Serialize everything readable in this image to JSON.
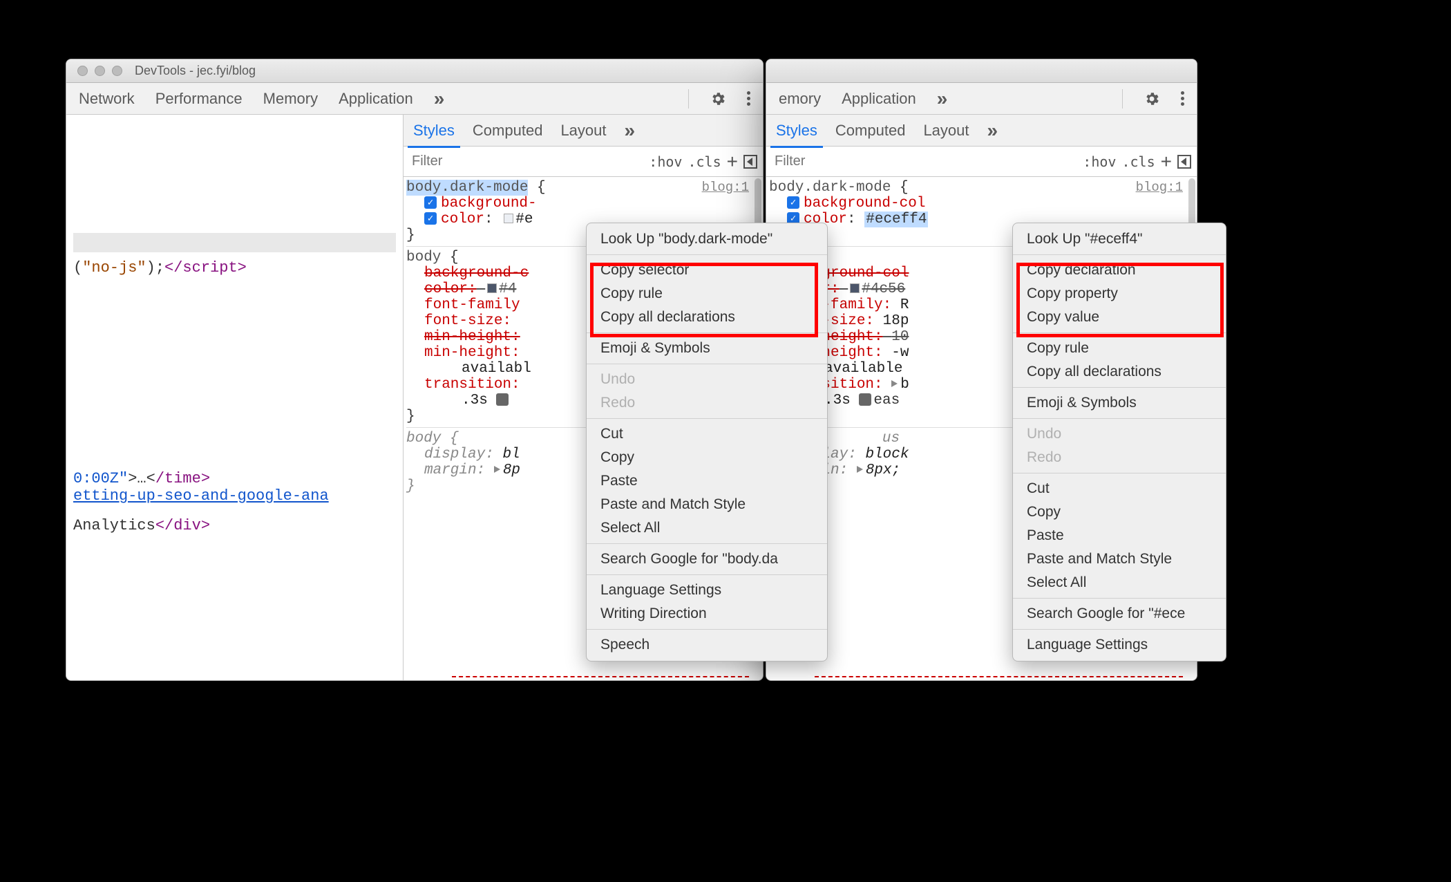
{
  "windowA": {
    "title": "DevTools - jec.fyi/blog",
    "tabs": [
      "Network",
      "Performance",
      "Memory",
      "Application"
    ],
    "more": "»",
    "dom": {
      "line1_pre": "(",
      "line1_str": "\"no-js\"",
      "line1_post": ");",
      "line1_close": "</script>",
      "line7_attr": "0:00Z\"",
      "line7_ell": ">…<",
      "line7_end": "/time>",
      "line8": "etting-up-seo-and-google-ana",
      "line10_text": "Analytics",
      "line10_close": "</div>"
    },
    "subtabs": [
      "Styles",
      "Computed",
      "Layout"
    ],
    "filter": {
      "placeholder": "Filter",
      "hov": ":hov",
      "cls": ".cls"
    },
    "rules": {
      "r1_sel": "body.dark-mode",
      "r1_brace": " {",
      "r1_origin": "blog:1",
      "r1_p1": "background-",
      "r1_p2_k": "color",
      "r1_p2_v": "#e",
      "r2_sel": "body",
      "r2_brace": " {",
      "r2_p1": "background-c",
      "r2_p2_k": "color:",
      "r2_p2_sw": "#4",
      "r2_p3": "font-family",
      "r2_p4": "font-size:",
      "r2_p5": "min-height:",
      "r2_p6": "min-height:",
      "r2_p6v": "availabl",
      "r2_p7": "transition:",
      "r2_p7v": ".3s ",
      "r3_sel": "body",
      "r3_brace": " {",
      "r3_p1_k": "display:",
      "r3_p1_v": "bl",
      "r3_p2_k": "margin:",
      "r3_p2_v": "8p"
    }
  },
  "windowB": {
    "tabs": [
      "emory",
      "Application"
    ],
    "more": "»",
    "subtabs": [
      "Styles",
      "Computed",
      "Layout"
    ],
    "filter": {
      "placeholder": "Filter",
      "hov": ":hov",
      "cls": ".cls"
    },
    "rules": {
      "r1_sel": "body.dark-mode",
      "r1_brace": " {",
      "r1_origin": "blog:1",
      "r1_p1": "background-col",
      "r1_p2_k": "color",
      "r1_p2_v": "#eceff4",
      "r2_sel": "body",
      "r2_brace": " {",
      "r2_p1": "background-col",
      "r2_p2_k": "color:",
      "r2_p2_sw": "#4c56",
      "r2_p3_k": "font-family:",
      "r2_p3_v": "R",
      "r2_p4_k": "font-size:",
      "r2_p4_v": "18p",
      "r2_p5_k": "min-height:",
      "r2_p5_v": "10",
      "r2_p6_k": "min-height:",
      "r2_p6_v": "-w",
      "r2_p6v2": "available",
      "r2_p7_k": "transition:",
      "r2_p7_v": "b",
      "r2_p7v2": ".3s ",
      "r3_sel": "body",
      "r3_brace": " {",
      "r3_ua": "us",
      "r3_p1_k": "display:",
      "r3_p1_v": "block",
      "r3_p2_k": "margin:",
      "r3_p2_v": "8px;"
    }
  },
  "ctxA": {
    "lookup": "Look Up \"body.dark-mode\"",
    "items1": [
      "Copy selector",
      "Copy rule",
      "Copy all declarations"
    ],
    "emoji": "Emoji & Symbols",
    "undo": "Undo",
    "redo": "Redo",
    "items2": [
      "Cut",
      "Copy",
      "Paste",
      "Paste and Match Style",
      "Select All"
    ],
    "search": "Search Google for \"body.da",
    "items3": [
      "Language Settings",
      "Writing Direction"
    ],
    "speech": "Speech"
  },
  "ctxB": {
    "lookup": "Look Up \"#eceff4\"",
    "items1": [
      "Copy declaration",
      "Copy property",
      "Copy value"
    ],
    "items1b": [
      "Copy rule",
      "Copy all declarations"
    ],
    "emoji": "Emoji & Symbols",
    "undo": "Undo",
    "redo": "Redo",
    "items2": [
      "Cut",
      "Copy",
      "Paste",
      "Paste and Match Style",
      "Select All"
    ],
    "search": "Search Google for \"#ece",
    "lang": "Language Settings"
  }
}
